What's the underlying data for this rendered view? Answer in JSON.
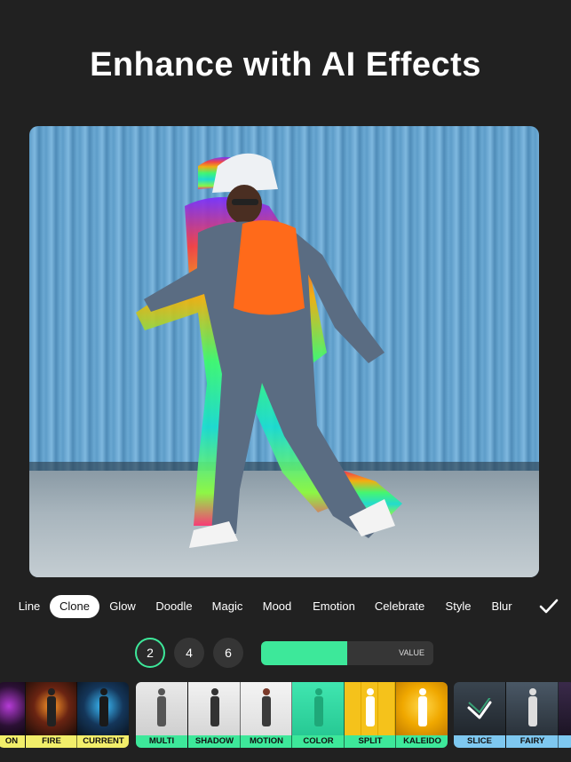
{
  "headline": "Enhance with AI Effects",
  "effect_tabs": [
    "Line",
    "Clone",
    "Glow",
    "Doodle",
    "Magic",
    "Mood",
    "Emotion",
    "Celebrate",
    "Style",
    "Blur"
  ],
  "active_tab": "Clone",
  "clone_counts": [
    "2",
    "4",
    "6"
  ],
  "selected_count": "2",
  "slider": {
    "label": "VALUE",
    "level": 0.5,
    "color": "#3de89a"
  },
  "thumbnail_groups": [
    {
      "caption_color": "#f2ee6a",
      "items": [
        "ON",
        "FIRE",
        "CURRENT"
      ]
    },
    {
      "caption_color": "#3de89a",
      "items": [
        "MULTI",
        "SHADOW",
        "MOTION",
        "COLOR",
        "SPLIT",
        "KALEIDO"
      ]
    },
    {
      "caption_color": "#7ec8f0",
      "items": [
        "SLICE",
        "FAIRY"
      ]
    }
  ]
}
